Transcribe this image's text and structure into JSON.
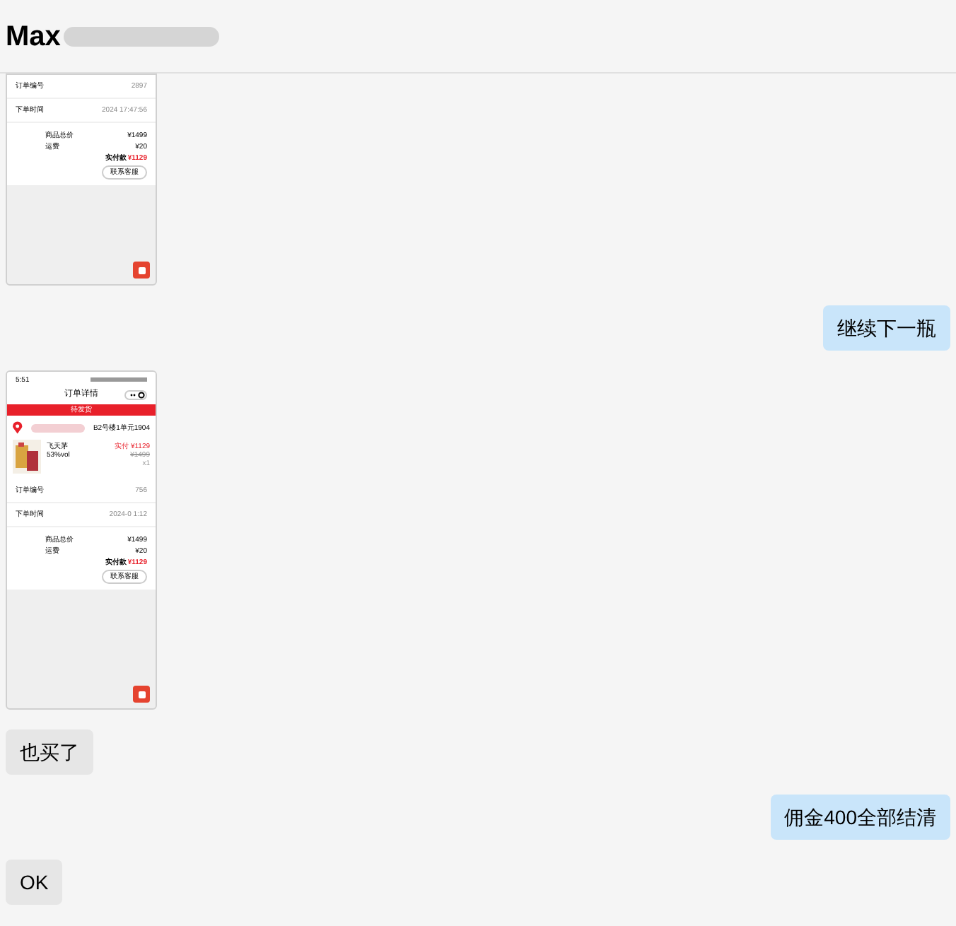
{
  "header": {
    "name": "Max"
  },
  "messages": [
    {
      "kind": "shot",
      "cropped": true,
      "rows": [
        {
          "label": "订单编号",
          "value": "2897"
        },
        {
          "label": "下单时间",
          "value": "2024        17:47:56"
        }
      ],
      "totals": [
        {
          "label": "商品总价",
          "value": "¥1499"
        },
        {
          "label": "运费",
          "value": "¥20"
        }
      ],
      "paid_label": "实付款",
      "paid": "¥1129",
      "button": "联系客服"
    },
    {
      "kind": "sent",
      "text": "继续下一瓶"
    },
    {
      "kind": "shot",
      "cropped": false,
      "time": "5:51",
      "title": "订单详情",
      "status": "待发货",
      "address": "B2号楼1单元1904",
      "product": {
        "name": "飞天茅",
        "spec": "53%vol",
        "pay": "实付 ¥1129",
        "price": "¥1499",
        "qty": "x1"
      },
      "rows": [
        {
          "label": "订单编号",
          "value": "756"
        },
        {
          "label": "下单时间",
          "value": "2024-0      1:12"
        }
      ],
      "totals": [
        {
          "label": "商品总价",
          "value": "¥1499"
        },
        {
          "label": "运费",
          "value": "¥20"
        }
      ],
      "paid_label": "实付款",
      "paid": "¥1129",
      "button": "联系客服"
    },
    {
      "kind": "received",
      "text": "也买了"
    },
    {
      "kind": "sent",
      "text": "佣金400全部结清"
    },
    {
      "kind": "received",
      "text": "OK"
    }
  ]
}
